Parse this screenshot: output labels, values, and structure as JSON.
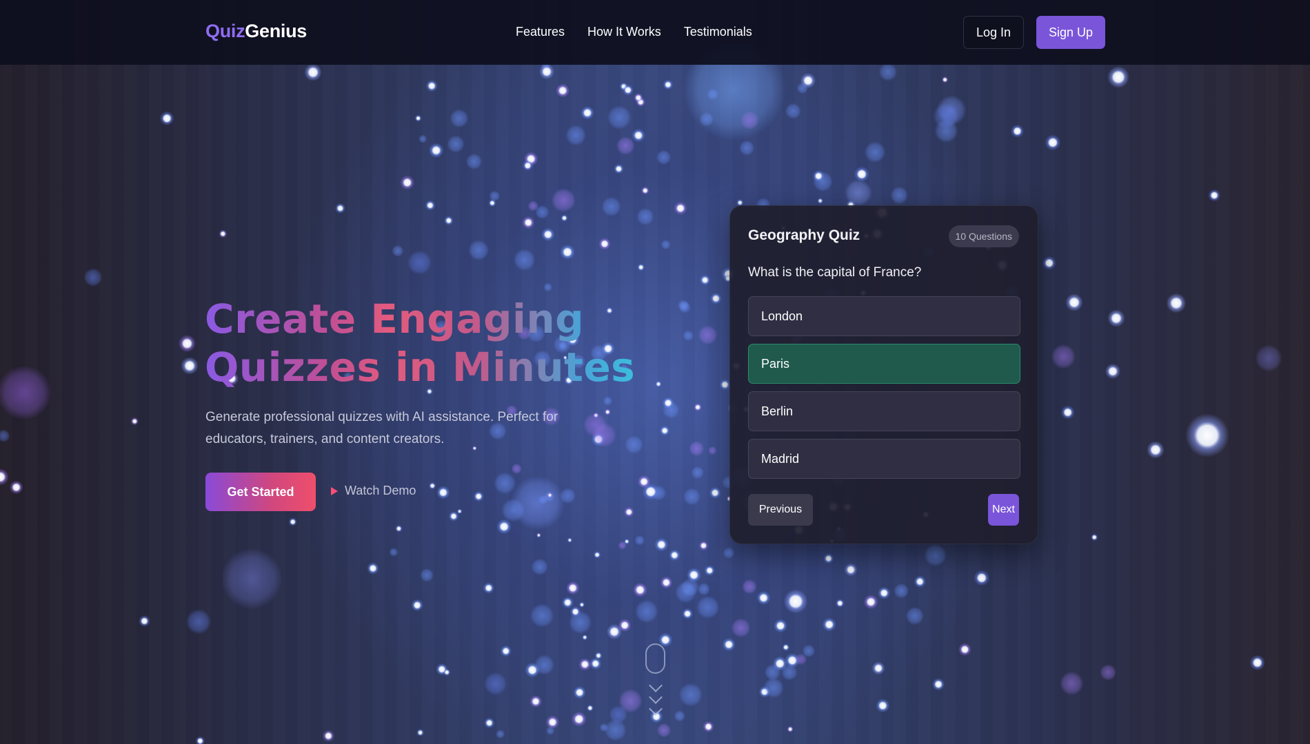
{
  "brand": {
    "part1": "Quiz",
    "part2": "Genius"
  },
  "nav": {
    "links": [
      "Features",
      "How It Works",
      "Testimonials"
    ],
    "login_label": "Log In",
    "signup_label": "Sign Up"
  },
  "hero": {
    "title_line1": "Create Engaging",
    "title_line2": "Quizzes in Minutes",
    "subtitle": "Generate professional quizzes with AI assistance. Perfect for educators, trainers, and content creators.",
    "cta_label": "Get Started",
    "demo_label": "Watch Demo"
  },
  "quiz_card": {
    "title": "Geography Quiz",
    "badge": "10 Questions",
    "question": "What is the capital of France?",
    "options": [
      "London",
      "Paris",
      "Berlin",
      "Madrid"
    ],
    "correct_option": "Paris",
    "prev_label": "Previous",
    "next_label": "Next"
  },
  "colors": {
    "accent": "#7a55d9",
    "correct": "#1f5a4c",
    "nav_bg": "#0e0f1e"
  },
  "icons": [
    "play-icon",
    "scroll-mouse-icon",
    "chevron-down-icon"
  ]
}
